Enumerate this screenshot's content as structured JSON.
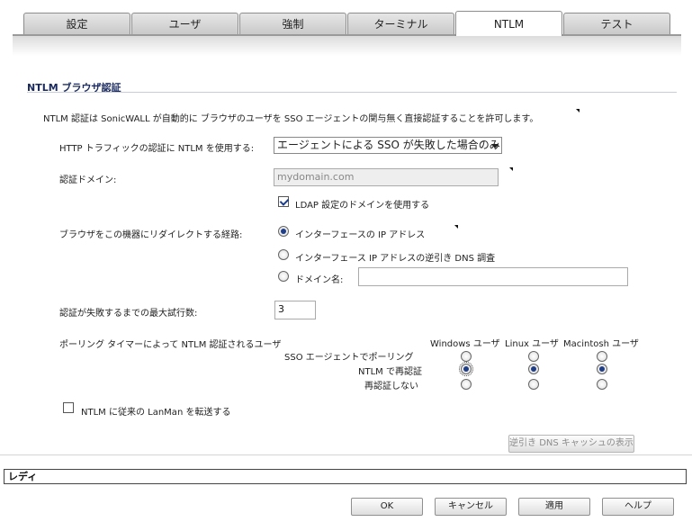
{
  "tabs": [
    {
      "label": "設定"
    },
    {
      "label": "ユーザ"
    },
    {
      "label": "強制"
    },
    {
      "label": "ターミナル"
    },
    {
      "label": "NTLM"
    },
    {
      "label": "テスト"
    }
  ],
  "section": {
    "title": "NTLM ブラウザ認証"
  },
  "description": "NTLM 認証は SonicWALL が自動的に ブラウザのユーザを SSO エージェントの関与無く直接認証することを許可します。",
  "http_auth": {
    "label": "HTTP トラフィックの認証に NTLM を使用する:",
    "selected": "エージェントによる SSO が失敗した場合のみ"
  },
  "auth_domain": {
    "label": "認証ドメイン:",
    "value": "mydomain.com",
    "use_ldap_label": "LDAP 設定のドメインを使用する",
    "use_ldap_checked": true
  },
  "redirect": {
    "label": "ブラウザをこの機器にリダイレクトする経路:",
    "options": [
      {
        "label": "インターフェースの IP アドレス",
        "checked": true
      },
      {
        "label": "インターフェース IP アドレスの逆引き DNS 調査",
        "checked": false
      },
      {
        "label": "ドメイン名:",
        "checked": false
      }
    ],
    "domain_value": ""
  },
  "max_attempts": {
    "label": "認証が失敗するまでの最大試行数:",
    "value": "3"
  },
  "polling": {
    "label": "ポーリング タイマーによって NTLM 認証されるユーザ",
    "columns": [
      "Windows ユーザ",
      "Linux ユーザ",
      "Macintosh ユーザ"
    ],
    "rows": [
      {
        "label": "SSO エージェントでポーリング",
        "selected": [
          false,
          false,
          false
        ]
      },
      {
        "label": "NTLM で再認証",
        "selected": [
          true,
          true,
          true
        ]
      },
      {
        "label": "再認証しない",
        "selected": [
          false,
          false,
          false
        ]
      }
    ]
  },
  "lanman": {
    "label": "NTLM に従来の LanMan を転送する",
    "checked": false
  },
  "dns_cache_button": "逆引き DNS キャッシュの表示",
  "status": "レディ",
  "buttons": {
    "ok": "OK",
    "cancel": "キャンセル",
    "apply": "適用",
    "help": "ヘルプ"
  }
}
